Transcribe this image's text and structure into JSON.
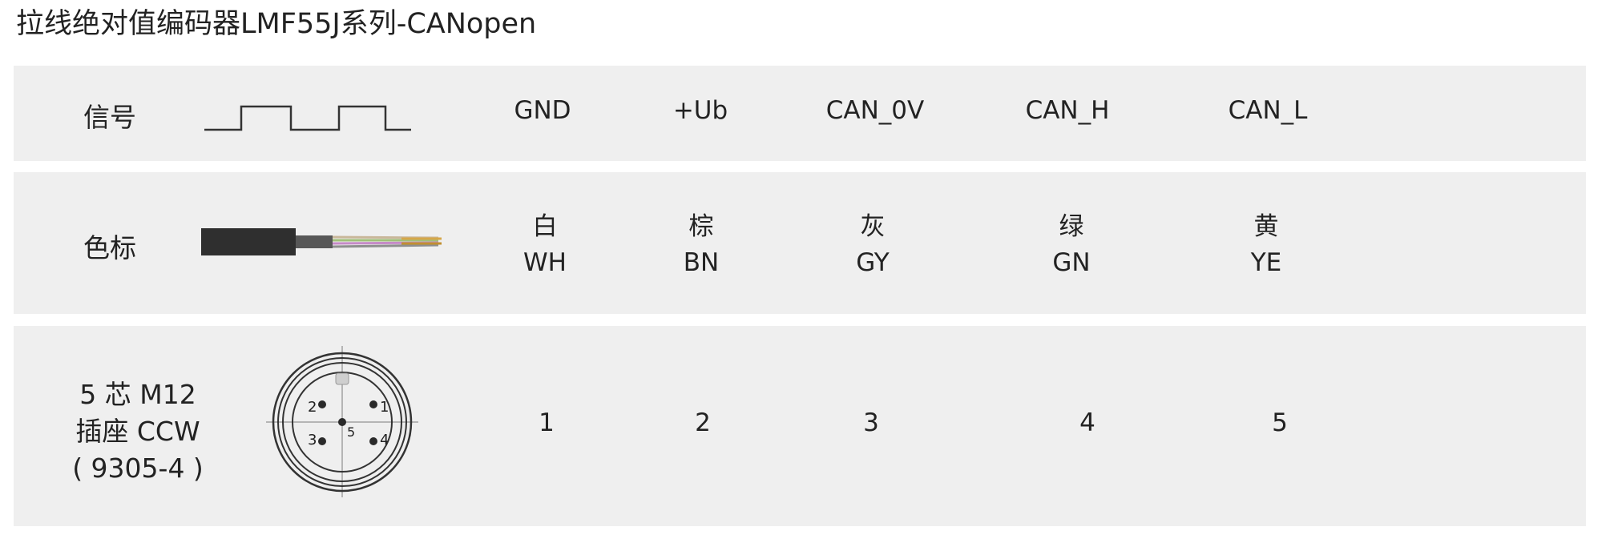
{
  "title": "拉线绝对值编码器LMF55J系列-CANopen",
  "rows": {
    "signal": {
      "label": "信号",
      "icon": "square-wave-icon",
      "values": [
        "GND",
        "+Ub",
        "CAN_0V",
        "CAN_H",
        "CAN_L"
      ]
    },
    "color": {
      "label": "色标",
      "icon": "cable-wires-icon",
      "values": [
        {
          "cn": "白",
          "en": "WH"
        },
        {
          "cn": "棕",
          "en": "BN"
        },
        {
          "cn": "灰",
          "en": "GY"
        },
        {
          "cn": "绿",
          "en": "GN"
        },
        {
          "cn": "黄",
          "en": "YE"
        }
      ],
      "wire_colors": [
        "#c9b79a",
        "#a0c079",
        "#c58ac7",
        "#8e8e8e",
        "#d6a74a"
      ]
    },
    "connector": {
      "label_lines": [
        "5 芯 M12",
        "插座 CCW",
        "( 9305-4 )"
      ],
      "icon": "m12-connector-pinout-icon",
      "pin_labels": [
        "1",
        "2",
        "3",
        "4",
        "5"
      ],
      "values": [
        "1",
        "2",
        "3",
        "4",
        "5"
      ]
    }
  },
  "colors": {
    "row_background": "#efefef",
    "text": "#222222",
    "cable_jacket": "#2f2f2f",
    "drawing_line": "#333333"
  }
}
